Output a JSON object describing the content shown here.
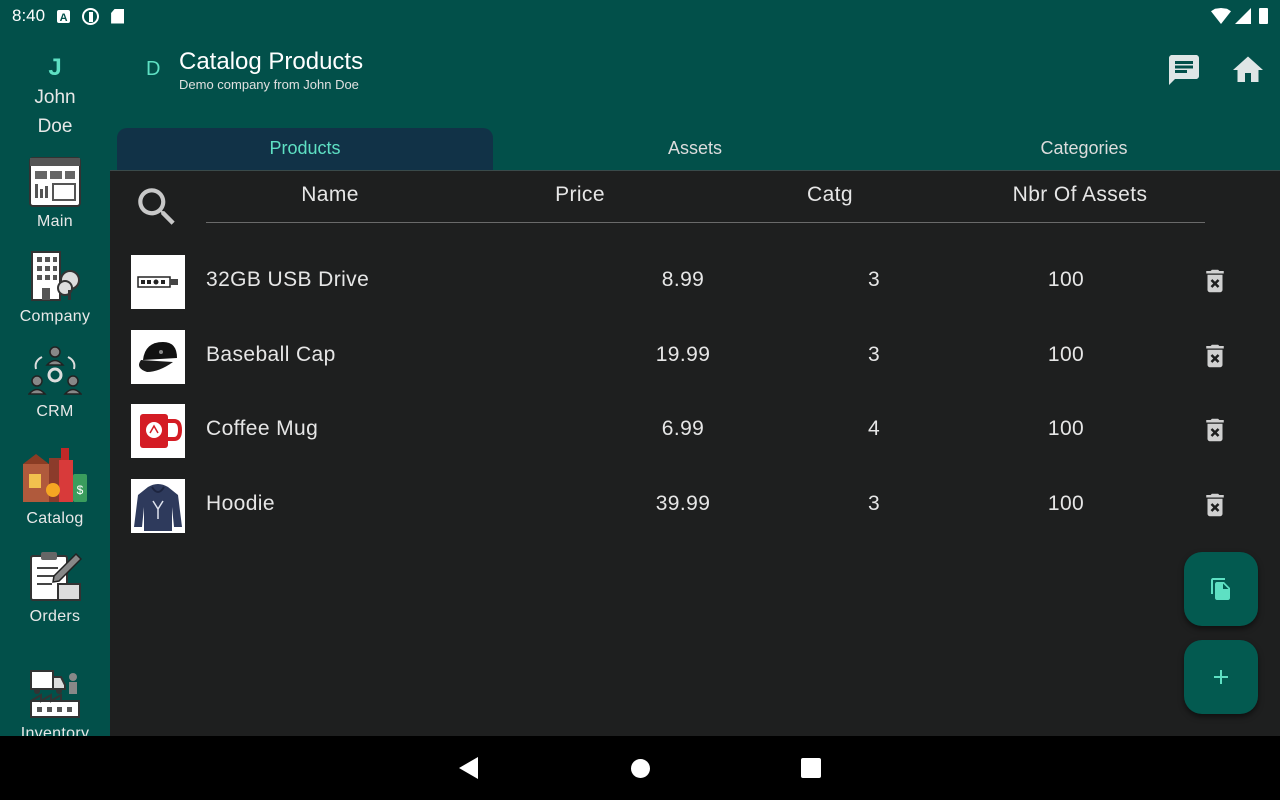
{
  "status_bar": {
    "time": "8:40",
    "icons": [
      "a-notification-icon",
      "p-notification-icon",
      "sd-card-icon",
      "wifi-icon",
      "signal-icon",
      "battery-icon"
    ],
    "a_glyph": "A"
  },
  "rail": {
    "user_initial": "J",
    "user_first": "John",
    "user_last": "Doe",
    "items": [
      {
        "label": "Main",
        "icon": "dashboard-icon"
      },
      {
        "label": "Company",
        "icon": "building-icon"
      },
      {
        "label": "CRM",
        "icon": "crm-network-icon"
      },
      {
        "label": "Catalog",
        "icon": "catalog-products-icon"
      },
      {
        "label": "Orders",
        "icon": "orders-clipboard-icon"
      },
      {
        "label": "Inventory",
        "icon": "inventory-warehouse-icon"
      }
    ]
  },
  "header": {
    "initial": "D",
    "title": "Catalog Products",
    "subtitle": "Demo company from John Doe",
    "actions": [
      "chat-icon",
      "home-icon"
    ]
  },
  "tabs": [
    {
      "label": "Products",
      "active": true
    },
    {
      "label": "Assets",
      "active": false
    },
    {
      "label": "Categories",
      "active": false
    }
  ],
  "table": {
    "columns": [
      "Name",
      "Price",
      "Catg",
      "Nbr Of Assets"
    ],
    "rows": [
      {
        "name": "32GB USB Drive",
        "price": "8.99",
        "catg": "3",
        "nbr": "100",
        "thumb": "usb-drive-image"
      },
      {
        "name": "Baseball Cap",
        "price": "19.99",
        "catg": "3",
        "nbr": "100",
        "thumb": "baseball-cap-image"
      },
      {
        "name": "Coffee Mug",
        "price": "6.99",
        "catg": "4",
        "nbr": "100",
        "thumb": "coffee-mug-image"
      },
      {
        "name": "Hoodie",
        "price": "39.99",
        "catg": "3",
        "nbr": "100",
        "thumb": "hoodie-image"
      }
    ]
  },
  "fabs": [
    "copy-icon",
    "add-icon"
  ],
  "colors": {
    "primary": "#02504a",
    "accent": "#5ee0c3",
    "background": "#1e1f1f",
    "active_tab": "#113247"
  }
}
